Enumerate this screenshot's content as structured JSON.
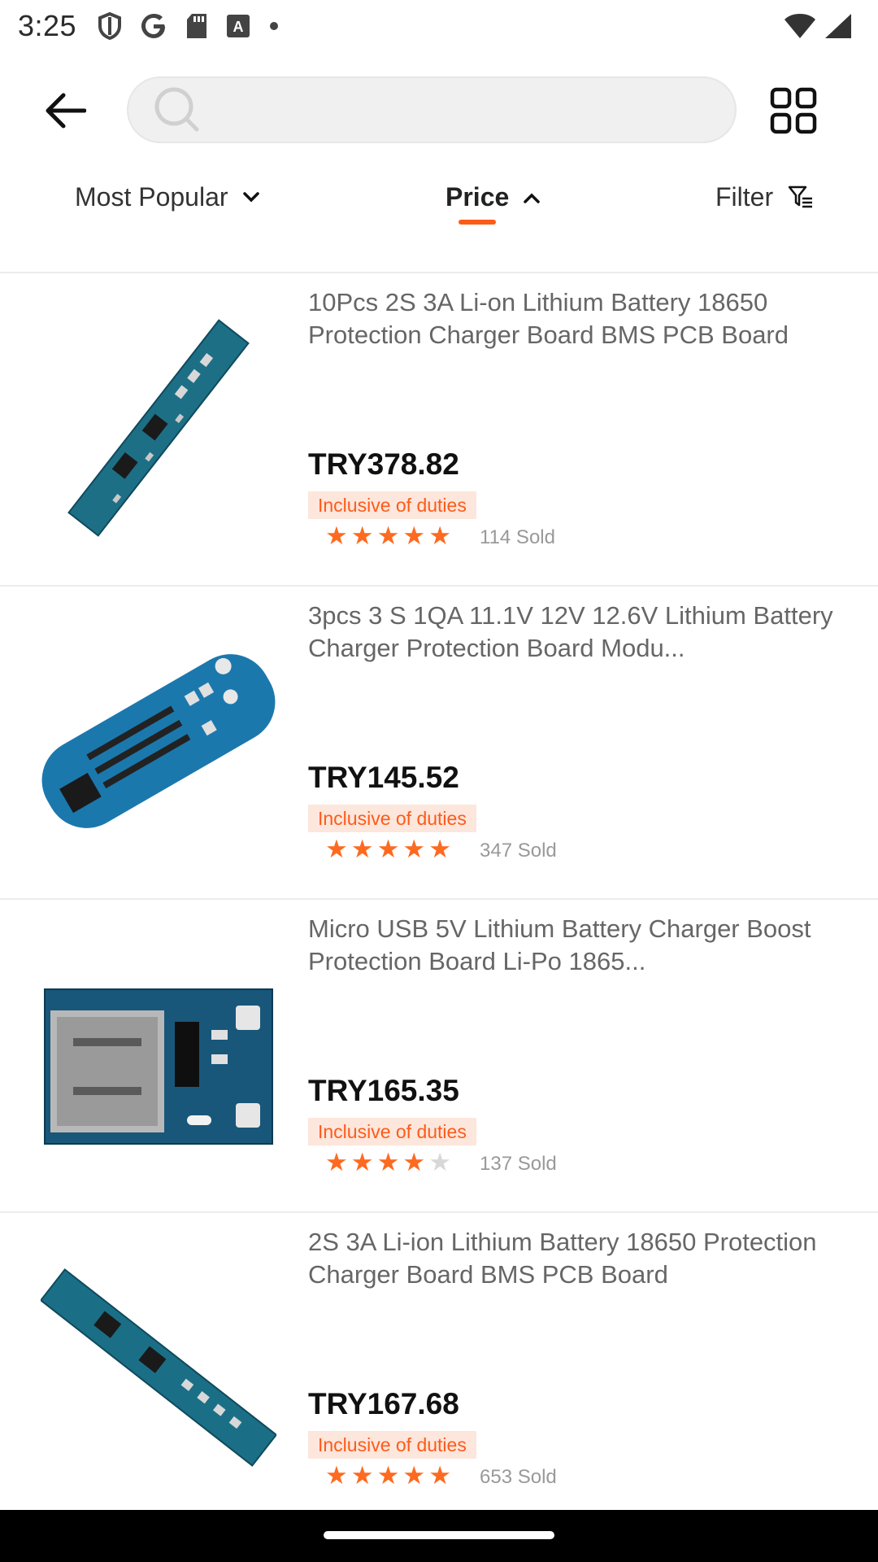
{
  "status_bar": {
    "time": "3:25",
    "icons": [
      "shield-icon",
      "google-icon",
      "sd-card-icon",
      "text-icon",
      "dot-icon"
    ],
    "right_icons": [
      "wifi-icon",
      "signal-icon"
    ]
  },
  "search": {
    "placeholder": ""
  },
  "sort": {
    "popular_label": "Most Popular",
    "price_label": "Price",
    "filter_label": "Filter",
    "accent_color": "#fd5b19"
  },
  "products": [
    {
      "title": "10Pcs 2S 3A Li-on Lithium Battery 18650 Protection Charger Board BMS PCB Board",
      "price": "TRY378.82",
      "badge": "Inclusive of duties",
      "rating": 5,
      "sold": "114 Sold"
    },
    {
      "title": "3pcs 3 S 1QA 11.1V 12V 12.6V Lithium Battery Charger Protection Board Modu...",
      "price": "TRY145.52",
      "badge": "Inclusive of duties",
      "rating": 5,
      "sold": "347 Sold"
    },
    {
      "title": "Micro USB 5V Lithium Battery Charger Boost Protection Board Li-Po 1865...",
      "price": "TRY165.35",
      "badge": "Inclusive of duties",
      "rating": 4,
      "sold": "137 Sold"
    },
    {
      "title": "2S 3A Li-ion Lithium Battery 18650 Protection Charger Board BMS PCB Board",
      "price": "TRY167.68",
      "badge": "Inclusive of duties",
      "rating": 5,
      "sold": "653 Sold"
    }
  ]
}
